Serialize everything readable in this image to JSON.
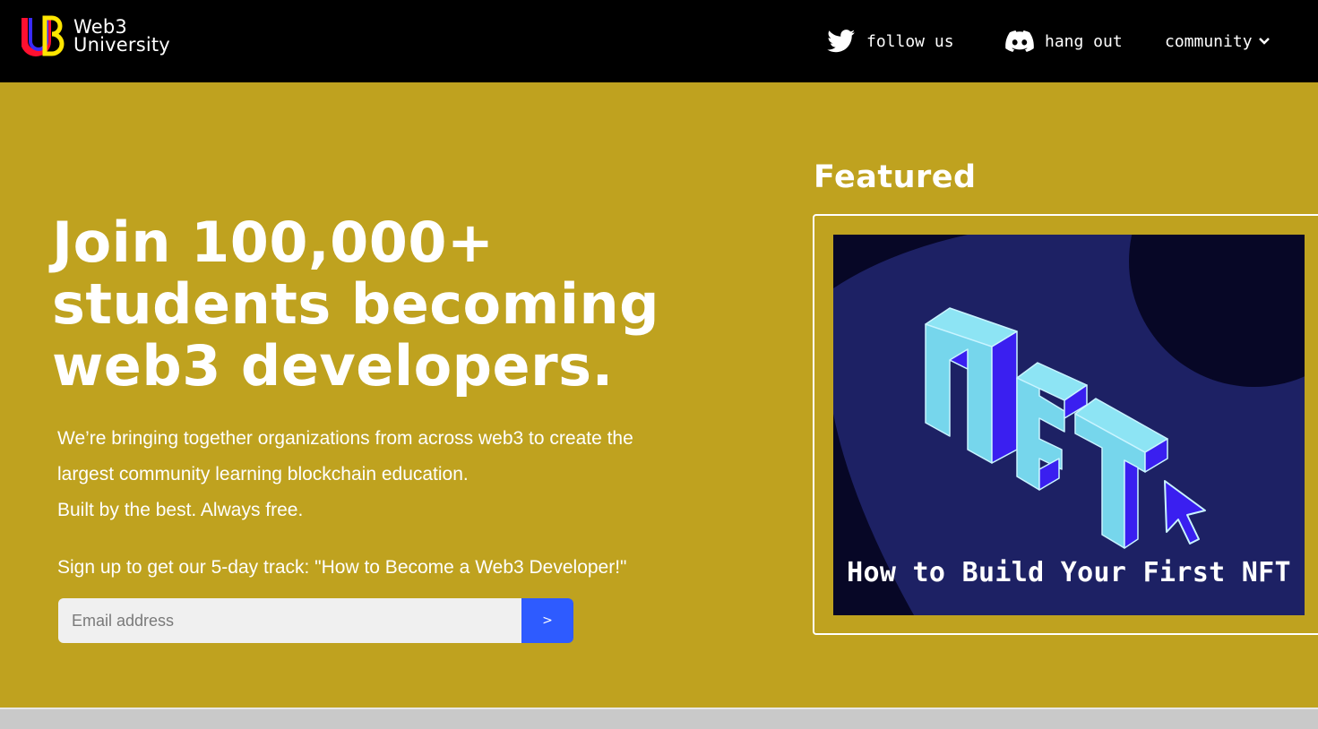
{
  "header": {
    "logo_text": [
      "Web3",
      "University"
    ],
    "nav": {
      "follow": "follow us",
      "hangout": "hang out",
      "community": "community"
    }
  },
  "hero": {
    "headline_lines": [
      "Join 100,000+",
      "students becoming",
      "web3 developers."
    ],
    "subtext_lines": [
      "We’re bringing together organizations from across web3 to create the",
      "largest community learning blockchain education.",
      "Built by the best. Always free."
    ],
    "signup_text": "Sign up to get our 5-day track: \"How to Become a Web3 Developer!\"",
    "email_placeholder": "Email address",
    "submit_label": ">"
  },
  "featured": {
    "title": "Featured",
    "card_caption": "How to Build Your First NFT",
    "card_image_text": "NFT"
  },
  "colors": {
    "page_bg": "#bfa21f",
    "topbar_bg": "#000000",
    "button": "#2e5bff",
    "card_bg": "#1e2260"
  },
  "icons": {
    "twitter": "twitter-icon",
    "discord": "discord-icon",
    "chevron": "chevron-down-icon"
  }
}
